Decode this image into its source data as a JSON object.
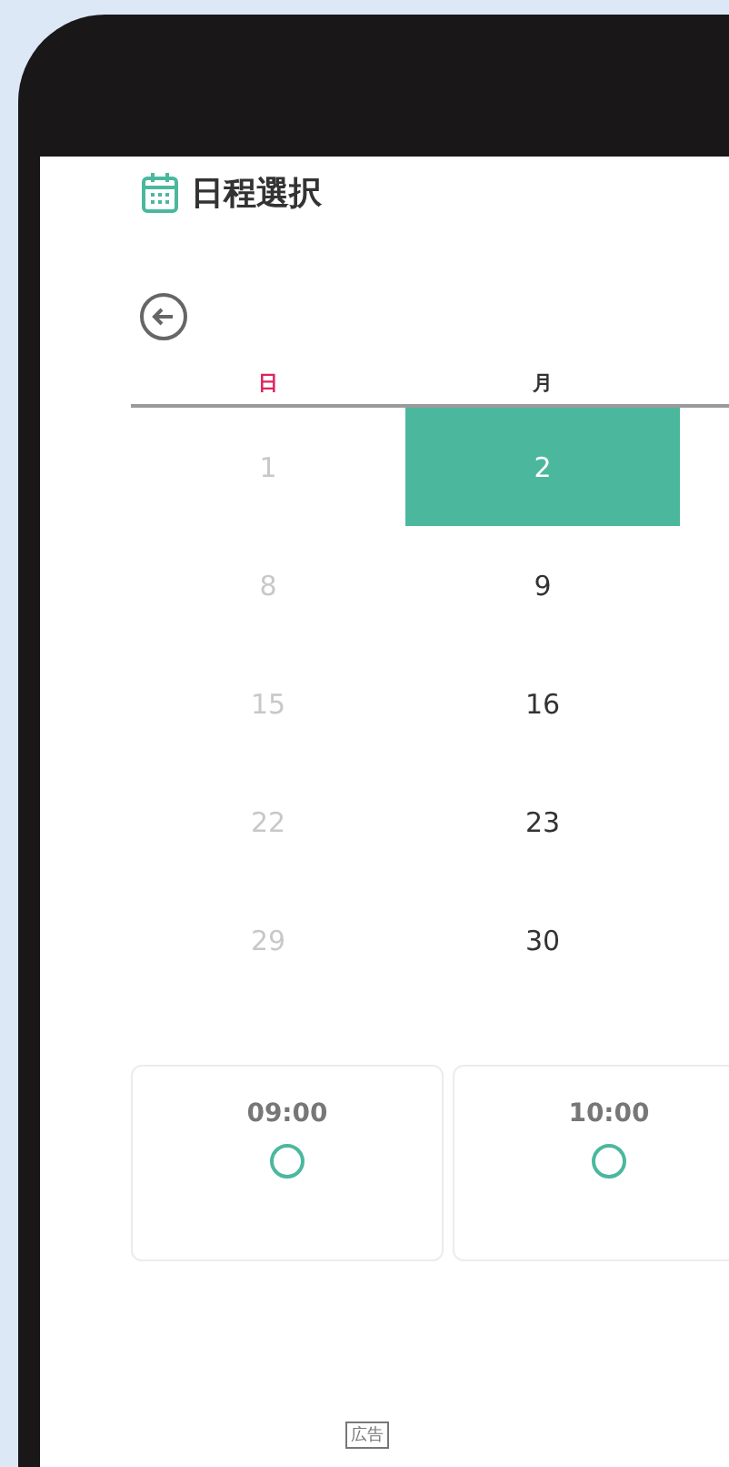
{
  "header": {
    "title": "日程選択"
  },
  "calendar": {
    "weekdays": [
      {
        "label": "日",
        "kind": "sunday"
      },
      {
        "label": "月",
        "kind": "weekday"
      }
    ],
    "weeks": [
      [
        {
          "day": "1",
          "disabled": true,
          "selected": false
        },
        {
          "day": "2",
          "disabled": false,
          "selected": true
        }
      ],
      [
        {
          "day": "8",
          "disabled": true,
          "selected": false
        },
        {
          "day": "9",
          "disabled": false,
          "selected": false
        }
      ],
      [
        {
          "day": "15",
          "disabled": true,
          "selected": false
        },
        {
          "day": "16",
          "disabled": false,
          "selected": false
        }
      ],
      [
        {
          "day": "22",
          "disabled": true,
          "selected": false
        },
        {
          "day": "23",
          "disabled": false,
          "selected": false
        }
      ],
      [
        {
          "day": "29",
          "disabled": true,
          "selected": false
        },
        {
          "day": "30",
          "disabled": false,
          "selected": false
        }
      ]
    ]
  },
  "time_slots": [
    {
      "time": "09:00"
    },
    {
      "time": "10:00"
    }
  ],
  "ad_label": "広告"
}
